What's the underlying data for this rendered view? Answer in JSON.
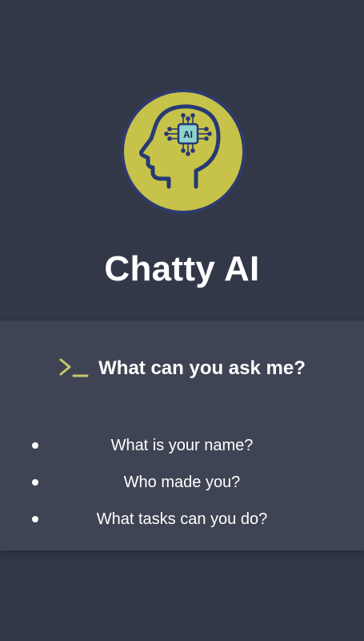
{
  "app": {
    "title": "Chatty AI",
    "logo": {
      "icon": "ai-head-icon",
      "chip_text": "AI",
      "accent": "#c6c24a",
      "ring": "#2f3a6e",
      "stroke": "#263a74",
      "chip_fill": "#8fd3cd"
    }
  },
  "panel": {
    "icon": "terminal-prompt-icon",
    "icon_color": "#c9c66a",
    "title": "What can you ask me?",
    "questions": [
      {
        "label": "What is your name?"
      },
      {
        "label": "Who made you?"
      },
      {
        "label": "What tasks can you do?"
      }
    ]
  },
  "colors": {
    "background": "#323848",
    "panel": "#3e4453",
    "text": "#ffffff"
  }
}
